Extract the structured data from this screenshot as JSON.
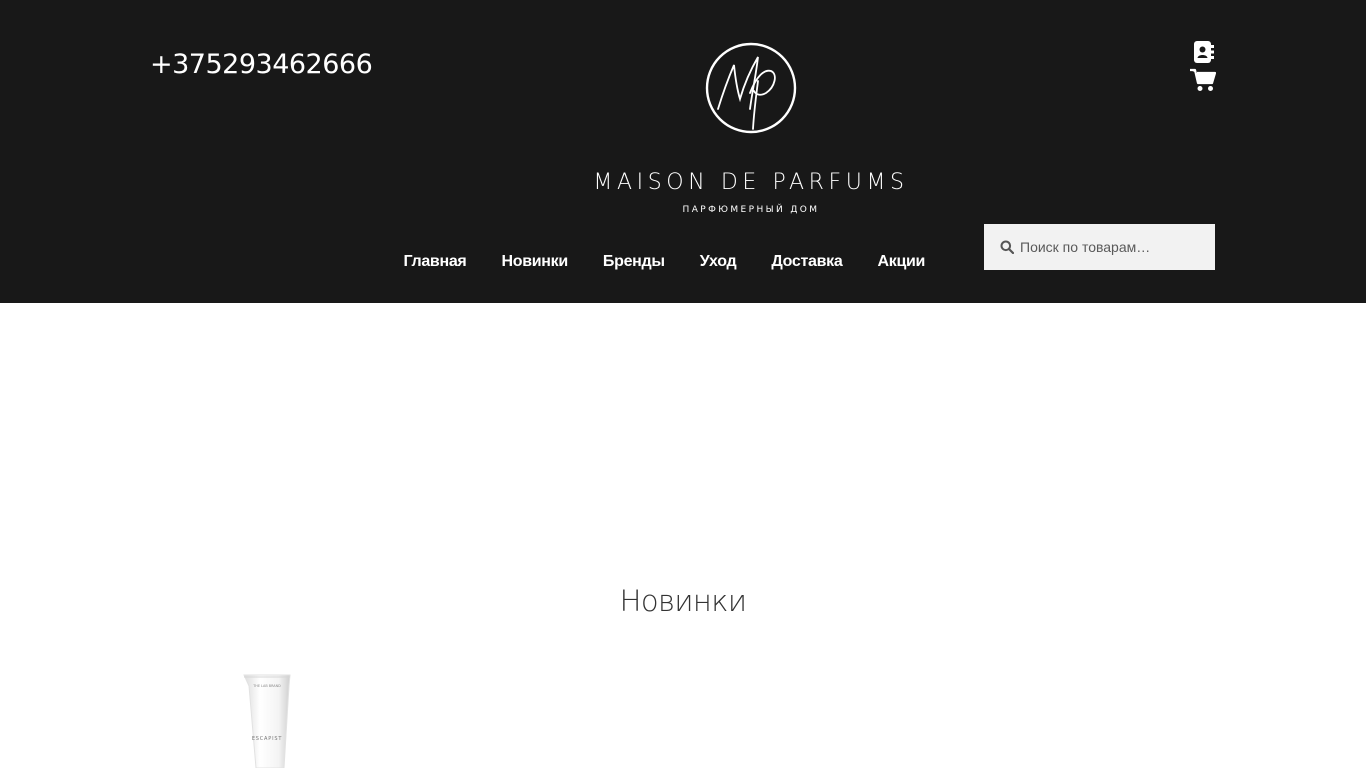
{
  "header": {
    "phone": "+375293462666",
    "logo": {
      "monogram": "Mp",
      "name": "MAISON DE PARFUMS",
      "tagline": "ПАРФЮМЕРНЫЙ ДОМ"
    },
    "icons": [
      "contacts-icon",
      "cart-icon"
    ]
  },
  "nav": {
    "items": [
      {
        "label": "Главная"
      },
      {
        "label": "Новинки"
      },
      {
        "label": "Бренды"
      },
      {
        "label": "Уход"
      },
      {
        "label": "Доставка"
      },
      {
        "label": "Акции"
      }
    ]
  },
  "search": {
    "placeholder": "Поиск по товарам…",
    "icon": "search-icon"
  },
  "main": {
    "section_title": "Новинки",
    "products": [
      {
        "image_text_brand": "THE LAB BRAND",
        "image_text_name": "ESCAPIST"
      }
    ]
  },
  "colors": {
    "header_bg": "#181818",
    "text_light": "#ffffff",
    "search_bg": "#f2f2f2",
    "title": "#333333"
  }
}
